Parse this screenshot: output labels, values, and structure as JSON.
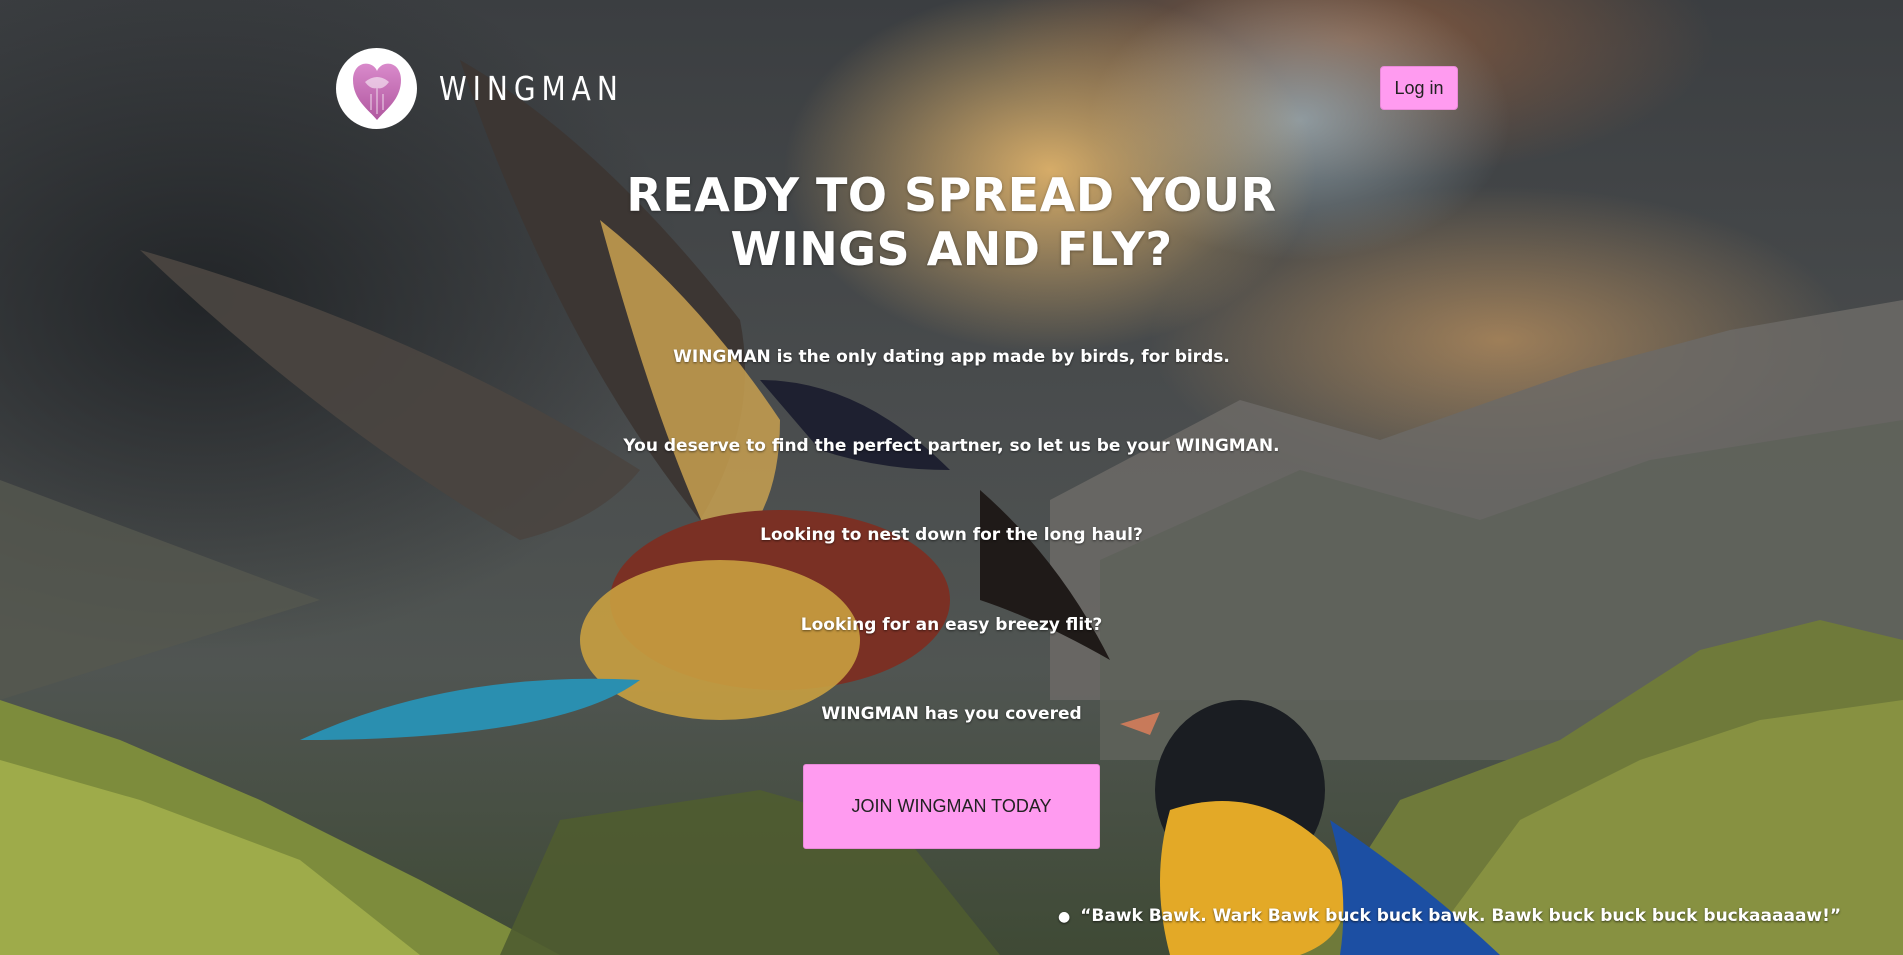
{
  "header": {
    "brand": "WINGMAN",
    "logo_icon": "winged-heart-icon",
    "login_label": "Log in"
  },
  "hero": {
    "title_line1": "READY TO SPREAD YOUR",
    "title_line2": "WINGS AND FLY?",
    "lines": [
      "WINGMAN is the only dating app made by birds, for birds.",
      "You deserve to find the perfect partner, so let us be your WINGMAN.",
      "Looking to nest down for the long haul?",
      "Looking for an easy breezy flit?",
      "WINGMAN has you covered"
    ],
    "cta_label": "JOIN WINGMAN TODAY"
  },
  "testimonials": [
    "“Bawk Bawk. Wark Bawk buck buck bawk. Bawk buck buck buck buckaaaaaw!”"
  ],
  "colors": {
    "accent": "#ff9bf0",
    "text": "#ffffff",
    "button_text": "#222222"
  }
}
